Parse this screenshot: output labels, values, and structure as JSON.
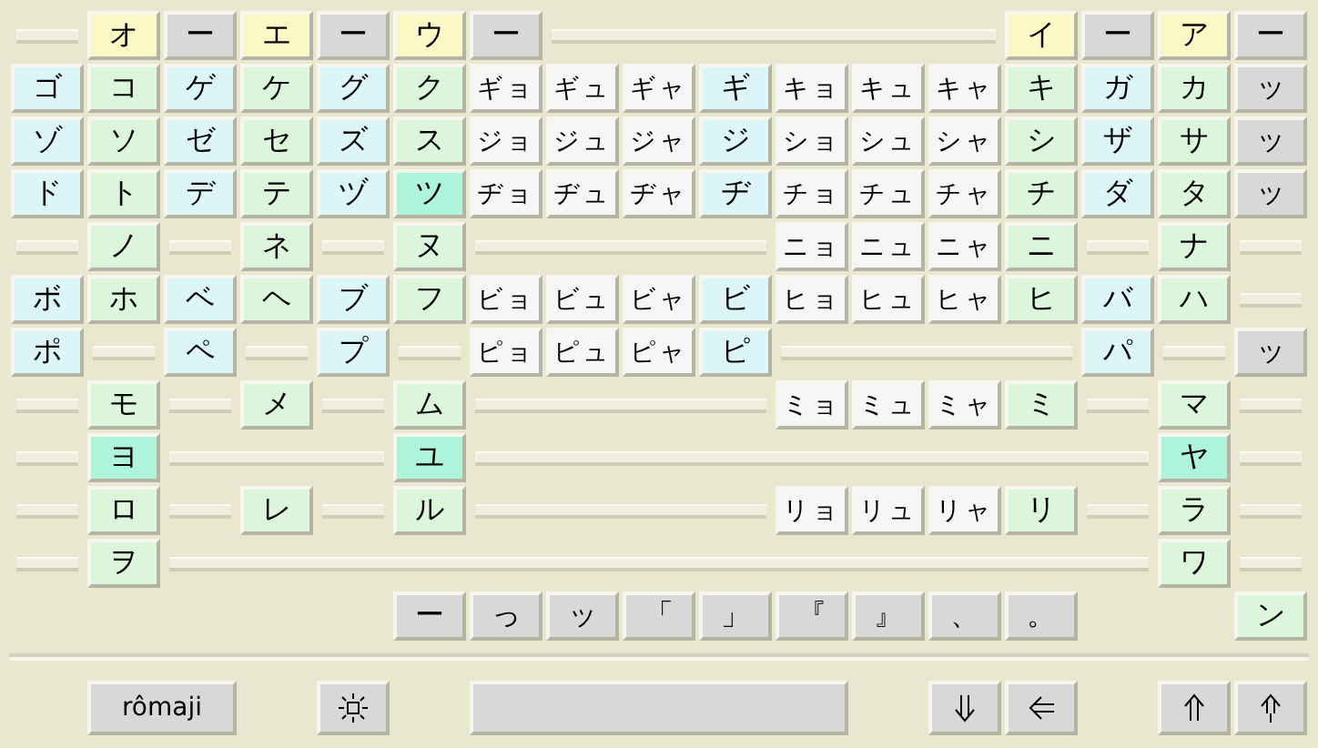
{
  "rows": [
    [
      {
        "kind": "slot"
      },
      {
        "label": "オ",
        "kind": "vowel"
      },
      {
        "label": "ー",
        "kind": "dash"
      },
      {
        "label": "エ",
        "kind": "vowel"
      },
      {
        "label": "ー",
        "kind": "dash"
      },
      {
        "label": "ウ",
        "kind": "vowel"
      },
      {
        "label": "ー",
        "kind": "dash"
      },
      {
        "kind": "slot"
      },
      {
        "kind": "slot"
      },
      {
        "kind": "slot"
      },
      {
        "kind": "slot"
      },
      {
        "kind": "slot"
      },
      {
        "kind": "slot"
      },
      {
        "label": "イ",
        "kind": "vowel"
      },
      {
        "label": "ー",
        "kind": "dash"
      },
      {
        "label": "ア",
        "kind": "vowel"
      },
      {
        "label": "ー",
        "kind": "dash"
      }
    ],
    [
      {
        "label": "ゴ",
        "kind": "voiced"
      },
      {
        "label": "コ",
        "kind": "base"
      },
      {
        "label": "ゲ",
        "kind": "voiced"
      },
      {
        "label": "ケ",
        "kind": "base"
      },
      {
        "label": "グ",
        "kind": "voiced"
      },
      {
        "label": "ク",
        "kind": "base"
      },
      {
        "label": "ギョ",
        "kind": "combo"
      },
      {
        "label": "ギュ",
        "kind": "combo"
      },
      {
        "label": "ギャ",
        "kind": "combo"
      },
      {
        "label": "ギ",
        "kind": "voiced"
      },
      {
        "label": "キョ",
        "kind": "combo"
      },
      {
        "label": "キュ",
        "kind": "combo"
      },
      {
        "label": "キャ",
        "kind": "combo"
      },
      {
        "label": "キ",
        "kind": "base"
      },
      {
        "label": "ガ",
        "kind": "voiced"
      },
      {
        "label": "カ",
        "kind": "base"
      },
      {
        "label": "ッ",
        "kind": "small"
      }
    ],
    [
      {
        "label": "ゾ",
        "kind": "voiced"
      },
      {
        "label": "ソ",
        "kind": "base"
      },
      {
        "label": "ゼ",
        "kind": "voiced"
      },
      {
        "label": "セ",
        "kind": "base"
      },
      {
        "label": "ズ",
        "kind": "voiced"
      },
      {
        "label": "ス",
        "kind": "base"
      },
      {
        "label": "ジョ",
        "kind": "combo"
      },
      {
        "label": "ジュ",
        "kind": "combo"
      },
      {
        "label": "ジャ",
        "kind": "combo"
      },
      {
        "label": "ジ",
        "kind": "voiced"
      },
      {
        "label": "ショ",
        "kind": "combo"
      },
      {
        "label": "シュ",
        "kind": "combo"
      },
      {
        "label": "シャ",
        "kind": "combo"
      },
      {
        "label": "シ",
        "kind": "base"
      },
      {
        "label": "ザ",
        "kind": "voiced"
      },
      {
        "label": "サ",
        "kind": "base"
      },
      {
        "label": "ッ",
        "kind": "small"
      }
    ],
    [
      {
        "label": "ド",
        "kind": "voiced"
      },
      {
        "label": "ト",
        "kind": "base"
      },
      {
        "label": "デ",
        "kind": "voiced"
      },
      {
        "label": "テ",
        "kind": "base"
      },
      {
        "label": "ヅ",
        "kind": "voiced"
      },
      {
        "label": "ツ",
        "kind": "mint"
      },
      {
        "label": "ヂョ",
        "kind": "combo"
      },
      {
        "label": "ヂュ",
        "kind": "combo"
      },
      {
        "label": "ヂャ",
        "kind": "combo"
      },
      {
        "label": "ヂ",
        "kind": "voiced"
      },
      {
        "label": "チョ",
        "kind": "combo"
      },
      {
        "label": "チュ",
        "kind": "combo"
      },
      {
        "label": "チャ",
        "kind": "combo"
      },
      {
        "label": "チ",
        "kind": "base"
      },
      {
        "label": "ダ",
        "kind": "voiced"
      },
      {
        "label": "タ",
        "kind": "base"
      },
      {
        "label": "ッ",
        "kind": "small"
      }
    ],
    [
      {
        "kind": "slot"
      },
      {
        "label": "ノ",
        "kind": "base"
      },
      {
        "kind": "slot"
      },
      {
        "label": "ネ",
        "kind": "base"
      },
      {
        "kind": "slot"
      },
      {
        "label": "ヌ",
        "kind": "base"
      },
      {
        "kind": "slot"
      },
      {
        "kind": "slot"
      },
      {
        "kind": "slot"
      },
      {
        "kind": "slot"
      },
      {
        "label": "ニョ",
        "kind": "combo"
      },
      {
        "label": "ニュ",
        "kind": "combo"
      },
      {
        "label": "ニャ",
        "kind": "combo"
      },
      {
        "label": "ニ",
        "kind": "base"
      },
      {
        "kind": "slot"
      },
      {
        "label": "ナ",
        "kind": "base"
      },
      {
        "kind": "slot"
      }
    ],
    [
      {
        "label": "ボ",
        "kind": "voiced"
      },
      {
        "label": "ホ",
        "kind": "base"
      },
      {
        "label": "ベ",
        "kind": "voiced"
      },
      {
        "label": "ヘ",
        "kind": "base"
      },
      {
        "label": "ブ",
        "kind": "voiced"
      },
      {
        "label": "フ",
        "kind": "base"
      },
      {
        "label": "ビョ",
        "kind": "combo"
      },
      {
        "label": "ビュ",
        "kind": "combo"
      },
      {
        "label": "ビャ",
        "kind": "combo"
      },
      {
        "label": "ビ",
        "kind": "voiced"
      },
      {
        "label": "ヒョ",
        "kind": "combo"
      },
      {
        "label": "ヒュ",
        "kind": "combo"
      },
      {
        "label": "ヒャ",
        "kind": "combo"
      },
      {
        "label": "ヒ",
        "kind": "base"
      },
      {
        "label": "バ",
        "kind": "voiced"
      },
      {
        "label": "ハ",
        "kind": "base"
      },
      {
        "kind": "slot"
      }
    ],
    [
      {
        "label": "ポ",
        "kind": "voiced"
      },
      {
        "kind": "slot"
      },
      {
        "label": "ペ",
        "kind": "voiced"
      },
      {
        "kind": "slot"
      },
      {
        "label": "プ",
        "kind": "voiced"
      },
      {
        "kind": "slot"
      },
      {
        "label": "ピョ",
        "kind": "combo"
      },
      {
        "label": "ピュ",
        "kind": "combo"
      },
      {
        "label": "ピャ",
        "kind": "combo"
      },
      {
        "label": "ピ",
        "kind": "voiced"
      },
      {
        "kind": "slot"
      },
      {
        "kind": "slot"
      },
      {
        "kind": "slot"
      },
      {
        "kind": "slot"
      },
      {
        "label": "パ",
        "kind": "voiced"
      },
      {
        "kind": "slot"
      },
      {
        "label": "ッ",
        "kind": "small"
      }
    ],
    [
      {
        "kind": "slot"
      },
      {
        "label": "モ",
        "kind": "base"
      },
      {
        "kind": "slot"
      },
      {
        "label": "メ",
        "kind": "base"
      },
      {
        "kind": "slot"
      },
      {
        "label": "ム",
        "kind": "base"
      },
      {
        "kind": "slot"
      },
      {
        "kind": "slot"
      },
      {
        "kind": "slot"
      },
      {
        "kind": "slot"
      },
      {
        "label": "ミョ",
        "kind": "combo"
      },
      {
        "label": "ミュ",
        "kind": "combo"
      },
      {
        "label": "ミャ",
        "kind": "combo"
      },
      {
        "label": "ミ",
        "kind": "base"
      },
      {
        "kind": "slot"
      },
      {
        "label": "マ",
        "kind": "base"
      },
      {
        "kind": "slot"
      }
    ],
    [
      {
        "kind": "slot"
      },
      {
        "label": "ヨ",
        "kind": "mint"
      },
      {
        "kind": "slot"
      },
      {
        "kind": "slot"
      },
      {
        "kind": "slot"
      },
      {
        "label": "ユ",
        "kind": "mint"
      },
      {
        "kind": "slot"
      },
      {
        "kind": "slot"
      },
      {
        "kind": "slot"
      },
      {
        "kind": "slot"
      },
      {
        "kind": "slot"
      },
      {
        "kind": "slot"
      },
      {
        "kind": "slot"
      },
      {
        "kind": "slot"
      },
      {
        "kind": "slot"
      },
      {
        "label": "ヤ",
        "kind": "mint"
      },
      {
        "kind": "slot"
      }
    ],
    [
      {
        "kind": "slot"
      },
      {
        "label": "ロ",
        "kind": "base"
      },
      {
        "kind": "slot"
      },
      {
        "label": "レ",
        "kind": "base"
      },
      {
        "kind": "slot"
      },
      {
        "label": "ル",
        "kind": "base"
      },
      {
        "kind": "slot"
      },
      {
        "kind": "slot"
      },
      {
        "kind": "slot"
      },
      {
        "kind": "slot"
      },
      {
        "label": "リョ",
        "kind": "combo"
      },
      {
        "label": "リュ",
        "kind": "combo"
      },
      {
        "label": "リャ",
        "kind": "combo"
      },
      {
        "label": "リ",
        "kind": "base"
      },
      {
        "kind": "slot"
      },
      {
        "label": "ラ",
        "kind": "base"
      },
      {
        "kind": "slot"
      }
    ],
    [
      {
        "kind": "slot"
      },
      {
        "label": "ヲ",
        "kind": "base"
      },
      {
        "kind": "slot"
      },
      {
        "kind": "slot"
      },
      {
        "kind": "slot"
      },
      {
        "kind": "slot"
      },
      {
        "kind": "slot"
      },
      {
        "kind": "slot"
      },
      {
        "kind": "slot"
      },
      {
        "kind": "slot"
      },
      {
        "kind": "slot"
      },
      {
        "kind": "slot"
      },
      {
        "kind": "slot"
      },
      {
        "kind": "slot"
      },
      {
        "kind": "slot"
      },
      {
        "label": "ワ",
        "kind": "base"
      },
      {
        "kind": "slot"
      }
    ],
    [
      null,
      null,
      null,
      null,
      null,
      {
        "label": "ー",
        "kind": "dash"
      },
      {
        "label": "っ",
        "kind": "small"
      },
      {
        "label": "ッ",
        "kind": "small"
      },
      {
        "label": "「",
        "kind": "small"
      },
      {
        "label": "」",
        "kind": "small"
      },
      {
        "label": "『",
        "kind": "small"
      },
      {
        "label": "』",
        "kind": "small"
      },
      {
        "label": "、",
        "kind": "small"
      },
      {
        "label": "。",
        "kind": "small"
      },
      null,
      null,
      {
        "label": "ン",
        "kind": "base"
      }
    ]
  ],
  "bottom_bar": {
    "romaji_button": "rômaji",
    "keys": [
      {
        "kind": "sun"
      },
      {
        "kind": "blank"
      },
      {
        "kind": "down"
      },
      {
        "kind": "left"
      },
      {
        "kind": "up2"
      },
      {
        "kind": "up1"
      }
    ]
  }
}
